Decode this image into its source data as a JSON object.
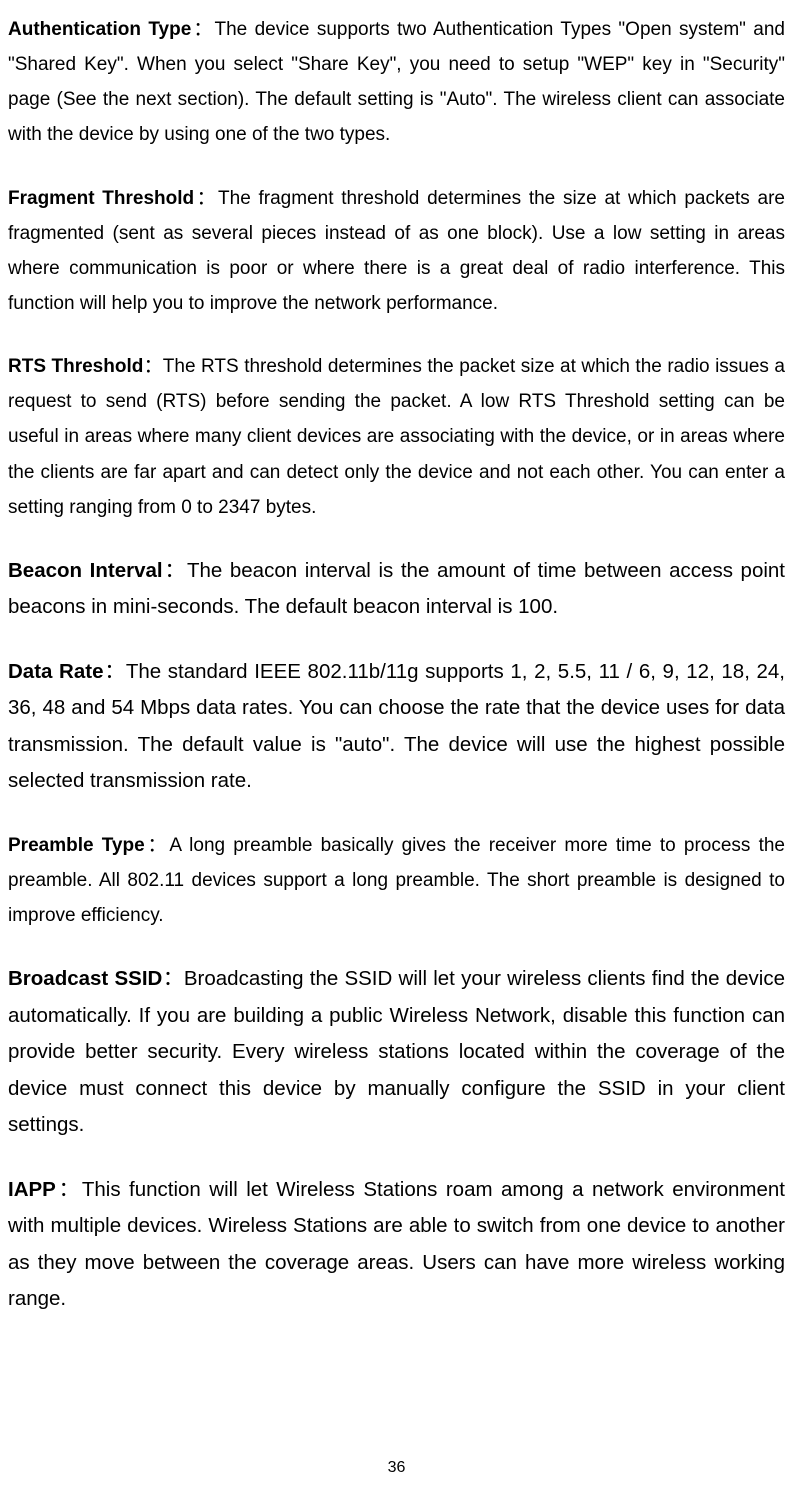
{
  "entries": [
    {
      "term": "Authentication Type",
      "sep": "：",
      "body": "The device supports two Authentication Types \"Open system\" and \"Shared Key\". When you select \"Share Key\", you need to setup \"WEP\" key in \"Security\" page (See the next section). The default setting is \"Auto\". The wireless client can associate with the device by using one of the two types.",
      "size": "normal"
    },
    {
      "term": "Fragment Threshold",
      "sep": "：",
      "body": "The fragment threshold determines the size at which packets are fragmented (sent as several pieces instead of as one block). Use a low setting in areas where communication is poor or where there is a great deal of radio interference. This function will help you to improve the network performance.",
      "size": "normal"
    },
    {
      "term": "RTS Threshold",
      "sep": "：",
      "body": "The RTS threshold determines the packet size at which the radio issues a request to send (RTS) before sending the packet. A low RTS Threshold setting can be useful in areas where many client devices are associating with the device, or in areas where the clients are far apart and can detect only the device and not each other. You can enter a setting ranging from 0 to 2347 bytes.",
      "size": "normal"
    },
    {
      "term": "Beacon Interval",
      "sep": "：",
      "body": "The beacon interval is the amount of time between access point beacons in mini-seconds. The default beacon interval is 100.",
      "size": "medium"
    },
    {
      "term": "Data Rate",
      "sep": "：",
      "body": "The standard IEEE 802.11b/11g supports 1, 2, 5.5, 11 / 6, 9, 12, 18, 24, 36, 48 and 54 Mbps data rates. You can choose the rate that the device uses for data transmission. The default value is \"auto\". The device will use the highest possible selected transmission rate.",
      "size": "medium"
    },
    {
      "term": "Preamble Type",
      "sep": "：",
      "body": "A long preamble basically gives the receiver more time to process the preamble. All 802.11 devices support a long preamble. The short preamble is designed to improve efficiency.",
      "size": "normal"
    },
    {
      "term": "Broadcast SSID",
      "sep": "：",
      "body": "Broadcasting the SSID will let your wireless clients find the device automatically. If you are building a public Wireless Network, disable this function can provide better security. Every wireless stations located within the coverage of the device must connect this device by manually configure the SSID in your client settings.",
      "size": "medium"
    },
    {
      "term": "IAPP",
      "sep": "：",
      "body": "This function will let Wireless Stations roam among a network environment with multiple devices. Wireless Stations are able to switch from one device to another as they move between the coverage areas. Users can have more wireless working range.",
      "size": "medium"
    }
  ],
  "page_number": "36"
}
